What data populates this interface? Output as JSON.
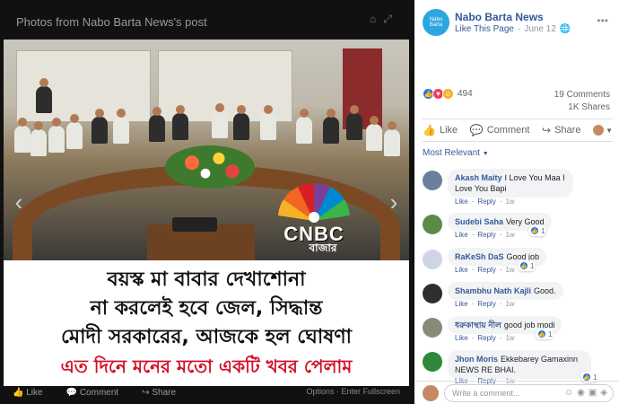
{
  "photo": {
    "title": "Photos from Nabo Barta News's post",
    "caption": {
      "line1": "বয়স্ক মা বাবার দেখাশোনা",
      "line2": "না করলেই হবে জেল, সিদ্ধান্ত",
      "line3": "মোদী সরকারের, আজকে হল ঘোষণা",
      "line4": "এত দিনে মনের মতো একটি খবর পেলাম"
    },
    "logo": {
      "text": "CNBC",
      "subtext": "বাজার"
    },
    "actions": {
      "like": "Like",
      "comment": "Comment",
      "share": "Share"
    },
    "meta": "Options  ·  Enter Fullscreen"
  },
  "post": {
    "page_name": "Nabo Barta News",
    "avatar_text": "Nabo Barta",
    "like_page": "Like This Page",
    "date": "June 12",
    "reactions_count": "494",
    "comments_count": "19 Comments",
    "shares_count": "1K Shares",
    "actions": {
      "like": "Like",
      "comment": "Comment",
      "share": "Share"
    },
    "sort_label": "Most Relevant"
  },
  "comments": [
    {
      "name": "Akash Maity",
      "text": "I Love You Maa I Love You Bapi",
      "like": "Like",
      "reply": "Reply",
      "time": "1w",
      "avatar_color": "#6b7f9e"
    },
    {
      "name": "Sudebi Saha",
      "text": "Very Good",
      "like": "Like",
      "reply": "Reply",
      "time": "1w",
      "reactions": "1",
      "avatar_color": "#5c8a4a"
    },
    {
      "name": "RaKeSh DaS",
      "text": "Good job",
      "like": "Like",
      "reply": "Reply",
      "time": "1w",
      "reactions": "1",
      "avatar_color": "#cfd6e3"
    },
    {
      "name": "Shambhu Nath Kajli",
      "text": "Good.",
      "like": "Like",
      "reply": "Reply",
      "time": "1w",
      "avatar_color": "#2e2e2e"
    },
    {
      "name": "ধরুকাস্থায় নীল",
      "text": "good job modi",
      "like": "Like",
      "reply": "Reply",
      "time": "1w",
      "reactions": "1",
      "avatar_color": "#8a8a7a"
    },
    {
      "name": "Jhon Moris",
      "text": "Ekkebarey Gamaxinn NEWS RE BHAI.",
      "like": "Like",
      "reply": "Reply",
      "time": "1w",
      "reactions": "1",
      "avatar_color": "#2d8a3a"
    }
  ],
  "composer": {
    "placeholder": "Write a comment..."
  },
  "colors": {
    "link": "#365899",
    "caption_red": "#d40f26",
    "background": "#000000"
  }
}
